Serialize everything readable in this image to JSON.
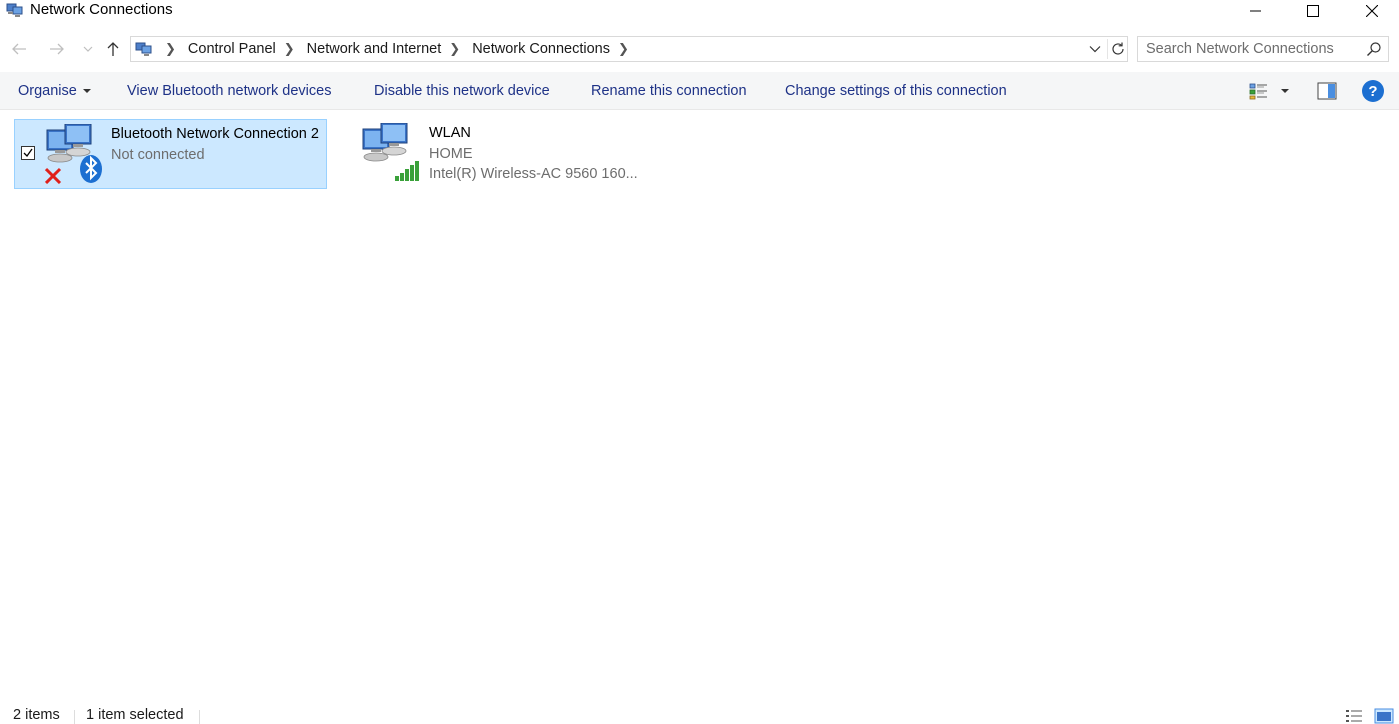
{
  "window": {
    "title": "Network Connections",
    "icon": "network-connections-icon"
  },
  "window_controls": {
    "minimize_icon": "minimize-icon",
    "maximize_icon": "maximize-icon",
    "close_icon": "close-icon"
  },
  "navigation": {
    "back_icon": "arrow-left-icon",
    "forward_icon": "arrow-right-icon",
    "recent_icon": "chevron-down-icon",
    "up_icon": "arrow-up-icon"
  },
  "address_bar": {
    "icon": "control-panel-icon",
    "breadcrumbs": [
      "Control Panel",
      "Network and Internet",
      "Network Connections"
    ],
    "dropdown_icon": "chevron-down-icon",
    "refresh_icon": "refresh-icon"
  },
  "search": {
    "placeholder": "Search Network Connections",
    "value": "",
    "icon": "search-icon"
  },
  "command_bar": {
    "organise": "Organise",
    "view_bluetooth": "View Bluetooth network devices",
    "disable": "Disable this network device",
    "rename": "Rename this connection",
    "change_settings": "Change settings of this connection",
    "view_options_icon": "change-view-icon",
    "preview_pane_icon": "preview-pane-icon",
    "help_label": "?"
  },
  "connections": [
    {
      "name": "Bluetooth Network Connection 2",
      "status": "Not connected",
      "selected": true,
      "checked": true,
      "icon": "bluetooth-network-icon",
      "overlay": "disconnected-x-icon"
    },
    {
      "name": "WLAN",
      "status": "HOME",
      "device": "Intel(R) Wireless-AC 9560 160...",
      "selected": false,
      "icon": "wireless-network-icon",
      "overlay": "signal-bars-icon"
    }
  ],
  "status_bar": {
    "item_count": "2 items",
    "selection": "1 item selected",
    "details_icon": "details-view-icon",
    "tiles_icon": "large-icons-view-icon"
  },
  "colors": {
    "selection_bg": "#cce8ff",
    "selection_border": "#99d1ff",
    "command_text": "#1e3287",
    "help_blue": "#1c6fd1",
    "signal_green": "#3aa13a",
    "error_red": "#e0201b"
  }
}
